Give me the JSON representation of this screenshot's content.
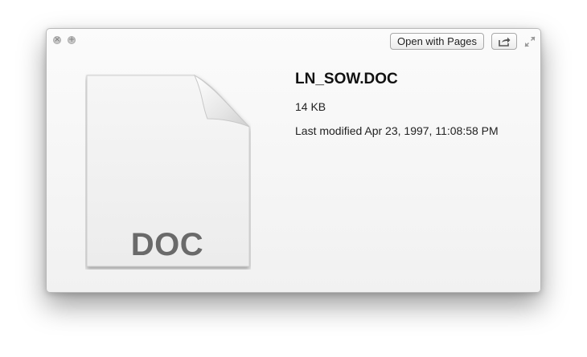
{
  "window": {
    "open_with_label": "Open with Pages",
    "close_icon": "close-icon",
    "fullsize_icon": "plus-icon",
    "share_icon": "share-icon",
    "expand_icon": "expand-arrows-icon"
  },
  "file": {
    "name": "LN_SOW.DOC",
    "size": "14 KB",
    "modified": "Last modified Apr 23, 1997, 11:08:58 PM",
    "icon_label": "DOC"
  }
}
